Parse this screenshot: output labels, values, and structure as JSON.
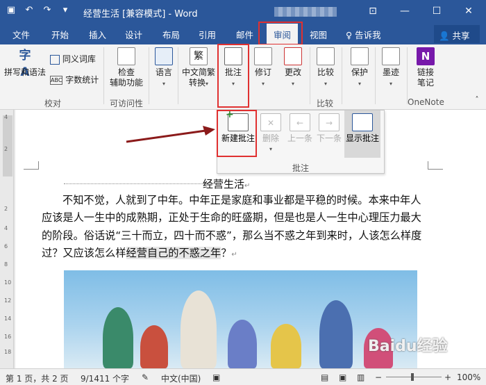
{
  "window": {
    "title": "经营生活 [兼容模式] - Word",
    "controls": {
      "ribbon_options": "⊡",
      "minimize": "—",
      "maximize": "☐",
      "close": "✕"
    }
  },
  "tabs": [
    {
      "label": "文件"
    },
    {
      "label": "开始"
    },
    {
      "label": "插入"
    },
    {
      "label": "设计"
    },
    {
      "label": "布局"
    },
    {
      "label": "引用"
    },
    {
      "label": "邮件"
    },
    {
      "label": "审阅"
    },
    {
      "label": "视图"
    },
    {
      "label": "告诉我"
    }
  ],
  "share_label": "共享",
  "ribbon": {
    "spelling": "拼写和语法",
    "thesaurus": "同义词库",
    "wordcount": "字数统计",
    "group_proofing": "校对",
    "check_accessibility_1": "检查",
    "check_accessibility_2": "辅助功能",
    "group_accessibility": "可访问性",
    "language": "语言",
    "chinese_convert_1": "中文简繁",
    "chinese_convert_2": "转换",
    "comments": "批注",
    "track": "修订",
    "changes": "更改",
    "compare": "比较",
    "group_compare": "比较",
    "protect": "保护",
    "ink": "墨迹",
    "linked_notes_1": "链接",
    "linked_notes_2": "笔记",
    "group_onenote": "OneNote"
  },
  "dropdown": {
    "new_comment": "新建批注",
    "delete": "删除",
    "previous": "上一条",
    "next": "下一条",
    "show_comments": "显示批注",
    "group_label": "批注"
  },
  "document": {
    "title": "经营生活",
    "para_before": "不知不觉，人就到了中年。中年正是家庭和事业都是平稳的时候。本来中年人应该是人一生中的成熟期，正处于生命的旺盛期，但是也是人一生中心理压力最大的阶段。俗话说“三十而立，四十而不惑”，那么当不惑之年到来时，人该怎么样度过？又应该怎么样",
    "para_selected": "经营自己的不惑之年",
    "para_after": "？"
  },
  "ruler_numbers": [
    "4",
    "2",
    "2",
    "4",
    "6",
    "8",
    "10",
    "12",
    "14",
    "16",
    "18",
    "20",
    "22"
  ],
  "status": {
    "page": "第 1 页，共 2 页",
    "words": "9/1411 个字",
    "language": "中文(中国)",
    "zoom": "100%",
    "zoom_minus": "−",
    "zoom_plus": "+"
  },
  "watermark": "Baidu经验",
  "colors": {
    "accent": "#2b579a",
    "highlight_red": "#e03030",
    "arrow": "#8b1a1a"
  }
}
